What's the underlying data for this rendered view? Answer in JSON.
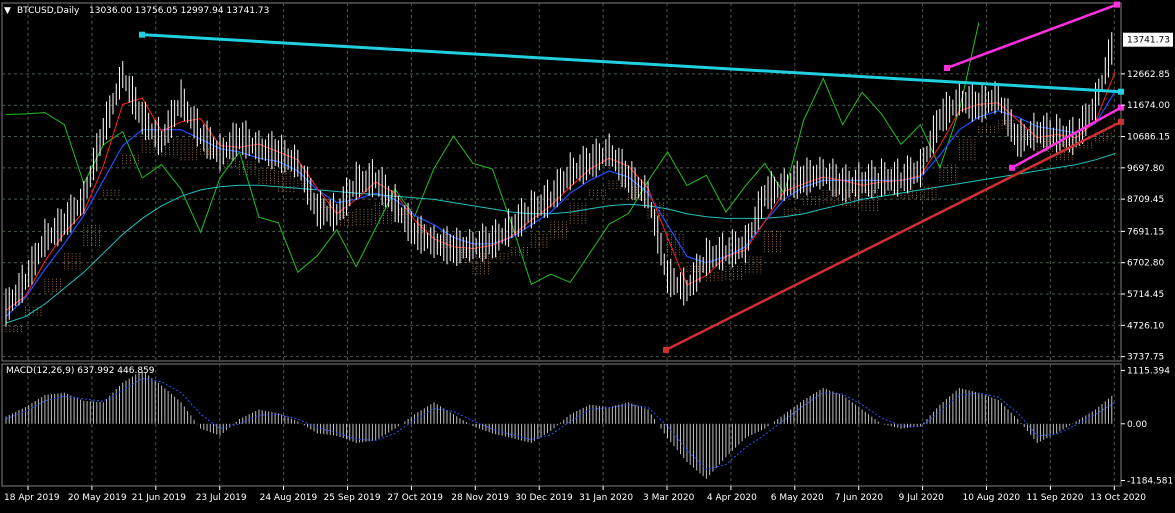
{
  "header": {
    "marker": "▼",
    "symbol": "BTCUSD,Daily",
    "ohlc": "13036.00 13756.05 12997.94 13741.73"
  },
  "macd_header": "MACD(12,26,9) 637.992 446.859",
  "colors": {
    "background": "#000000",
    "grid": "#4a5a4a",
    "candle": "#ffffff",
    "ma_fast": "#ff2020",
    "ma_mid": "#1e50ff",
    "ma_slow": "#20c0c0",
    "chikou": "#20c020",
    "cloud": "#ffb37a",
    "trend_top": "#20d0e0",
    "trend_support": "#d03030",
    "channel": "#ff30e0",
    "macd_hist": "#c0c0c0",
    "macd_signal": "#3050ff",
    "price_label_bg": "#ffffff"
  },
  "chart_data": [
    {
      "type": "line",
      "title": "BTCUSD,Daily",
      "xlabel": "",
      "ylabel": "",
      "x_ticks": [
        "18 Apr 2019",
        "20 May 2019",
        "21 Jun 2019",
        "23 Jul 2019",
        "24 Aug 2019",
        "25 Sep 2019",
        "27 Oct 2019",
        "28 Nov 2019",
        "30 Dec 2019",
        "31 Jan 2020",
        "3 Mar 2020",
        "4 Apr 2020",
        "6 May 2020",
        "7 Jun 2020",
        "9 Jul 2020",
        "10 Aug 2020",
        "11 Sep 2020",
        "13 Oct 2020"
      ],
      "y_ticks": [
        "12662.85",
        "11674.00",
        "10686.15",
        "9697.80",
        "8709.45",
        "7691.15",
        "6702.80",
        "5714.45",
        "4726.10",
        "3737.75"
      ],
      "ylim": [
        3600,
        14900
      ],
      "last_price_label": "13741.73",
      "grid": true,
      "series": [
        {
          "values": [
            5200,
            6100,
            7400,
            7900,
            8700,
            10800,
            12600,
            11200,
            10500,
            11800,
            10700,
            10100,
            10600,
            10300,
            10100,
            9800,
            8300,
            8200,
            9200,
            9300,
            8500,
            7600,
            7300,
            7100,
            7200,
            7300,
            7800,
            8300,
            8700,
            9500,
            9800,
            10200,
            9300,
            8800,
            6200,
            5800,
            6800,
            7000,
            7200,
            8800,
            9100,
            9300,
            9500,
            9100,
            9200,
            9300,
            9300,
            9600,
            11200,
            11800,
            11600,
            11900,
            10500,
            10800,
            10700,
            10600,
            11700,
            13741
          ]
        },
        {
          "values": [
            5000,
            5600,
            6500,
            7300,
            8200,
            9300,
            10400,
            10900,
            10900,
            10900,
            10600,
            10300,
            10200,
            10000,
            9900,
            9600,
            9000,
            8600,
            8700,
            8900,
            8700,
            8200,
            7900,
            7500,
            7300,
            7300,
            7500,
            7900,
            8300,
            8900,
            9300,
            9600,
            9400,
            8900,
            7900,
            6900,
            6700,
            6900,
            7200,
            8000,
            8700,
            9100,
            9300,
            9300,
            9300,
            9300,
            9300,
            9400,
            10100,
            10900,
            11300,
            11500,
            11300,
            11000,
            10900,
            10800,
            11100,
            12100
          ]
        },
        {
          "values": [
            4800,
            5000,
            5400,
            5900,
            6400,
            7000,
            7600,
            8100,
            8500,
            8800,
            9000,
            9100,
            9150,
            9150,
            9100,
            9050,
            9000,
            8950,
            8900,
            8850,
            8800,
            8750,
            8700,
            8600,
            8500,
            8400,
            8300,
            8250,
            8250,
            8300,
            8400,
            8500,
            8550,
            8500,
            8400,
            8250,
            8150,
            8100,
            8100,
            8100,
            8150,
            8250,
            8400,
            8550,
            8700,
            8800,
            8900,
            9000,
            9100,
            9200,
            9300,
            9400,
            9500,
            9600,
            9700,
            9800,
            9950,
            10150
          ]
        }
      ]
    },
    {
      "type": "bar",
      "title": "MACD(12,26,9)",
      "x_ticks": [
        "18 Apr 2019",
        "20 May 2019",
        "21 Jun 2019",
        "23 Jul 2019",
        "24 Aug 2019",
        "25 Sep 2019",
        "27 Oct 2019",
        "28 Nov 2019",
        "30 Dec 2019",
        "31 Jan 2020",
        "3 Mar 2020",
        "4 Apr 2020",
        "6 May 2020",
        "7 Jun 2020",
        "9 Jul 2020",
        "10 Aug 2020",
        "11 Sep 2020",
        "13 Oct 2020"
      ],
      "y_ticks": [
        "1115.394",
        "0.00",
        "-1184.581"
      ],
      "ylim": [
        -1300,
        1250
      ],
      "series": [
        {
          "values": [
            150,
            350,
            600,
            650,
            480,
            450,
            860,
            1115,
            800,
            450,
            -100,
            -250,
            100,
            300,
            220,
            50,
            -200,
            -250,
            -400,
            -350,
            -100,
            200,
            450,
            200,
            -50,
            -200,
            -300,
            -400,
            -150,
            200,
            400,
            350,
            450,
            300,
            -300,
            -800,
            -1150,
            -700,
            -300,
            -100,
            200,
            500,
            750,
            600,
            300,
            0,
            -100,
            -50,
            400,
            750,
            650,
            500,
            100,
            -400,
            -200,
            50,
            300,
            640
          ]
        },
        {
          "values": [
            100,
            260,
            480,
            580,
            520,
            470,
            700,
            950,
            880,
            650,
            200,
            -100,
            0,
            180,
            200,
            100,
            -80,
            -190,
            -320,
            -350,
            -200,
            80,
            320,
            260,
            60,
            -110,
            -230,
            -330,
            -230,
            50,
            300,
            340,
            400,
            340,
            -50,
            -550,
            -950,
            -850,
            -500,
            -230,
            80,
            380,
            650,
            620,
            400,
            120,
            -40,
            -60,
            250,
            600,
            640,
            560,
            230,
            -250,
            -220,
            -20,
            200,
            446
          ]
        }
      ]
    }
  ]
}
